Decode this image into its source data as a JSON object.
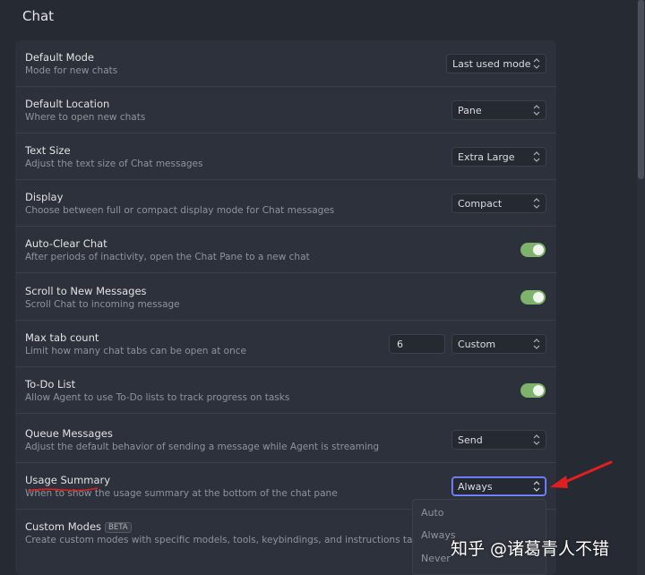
{
  "page": {
    "title": "Chat"
  },
  "settings": [
    {
      "title": "Default Mode",
      "desc": "Mode for new chats",
      "control": "select",
      "value": "Last used mode"
    },
    {
      "title": "Default Location",
      "desc": "Where to open new chats",
      "control": "select",
      "value": "Pane"
    },
    {
      "title": "Text Size",
      "desc": "Adjust the text size of Chat messages",
      "control": "select",
      "value": "Extra Large"
    },
    {
      "title": "Display",
      "desc": "Choose between full or compact display mode for Chat messages",
      "control": "select",
      "value": "Compact"
    },
    {
      "title": "Auto-Clear Chat",
      "desc": "After periods of inactivity, open the Chat Pane to a new chat",
      "control": "toggle",
      "on": true
    },
    {
      "title": "Scroll to New Messages",
      "desc": "Scroll Chat to incoming message",
      "control": "toggle",
      "on": true
    },
    {
      "title": "Max tab count",
      "desc": "Limit how many chat tabs can be open at once",
      "control": "select+input",
      "input_value": "6",
      "value": "Custom"
    },
    {
      "title": "To-Do List",
      "desc": "Allow Agent to use To-Do lists to track progress on tasks",
      "control": "toggle",
      "on": true
    },
    {
      "title": "Queue Messages",
      "desc": "Adjust the default behavior of sending a message while Agent is streaming",
      "control": "select",
      "value": "Send"
    },
    {
      "title": "Usage Summary",
      "desc": "When to show the usage summary at the bottom of the chat pane",
      "control": "select",
      "value": "Always",
      "open": true
    },
    {
      "title": "Custom Modes",
      "badge": "BETA",
      "desc": "Create custom modes with specific models, tools, keybindings, and instructions tailored to"
    }
  ],
  "dropdown": {
    "options": [
      "Auto",
      "Always",
      "Never"
    ]
  },
  "watermark": "知乎 @诸葛青人不错",
  "colors": {
    "toggle_on": "#7db36a",
    "focus": "#7e8dff",
    "annotation": "#e02020"
  }
}
